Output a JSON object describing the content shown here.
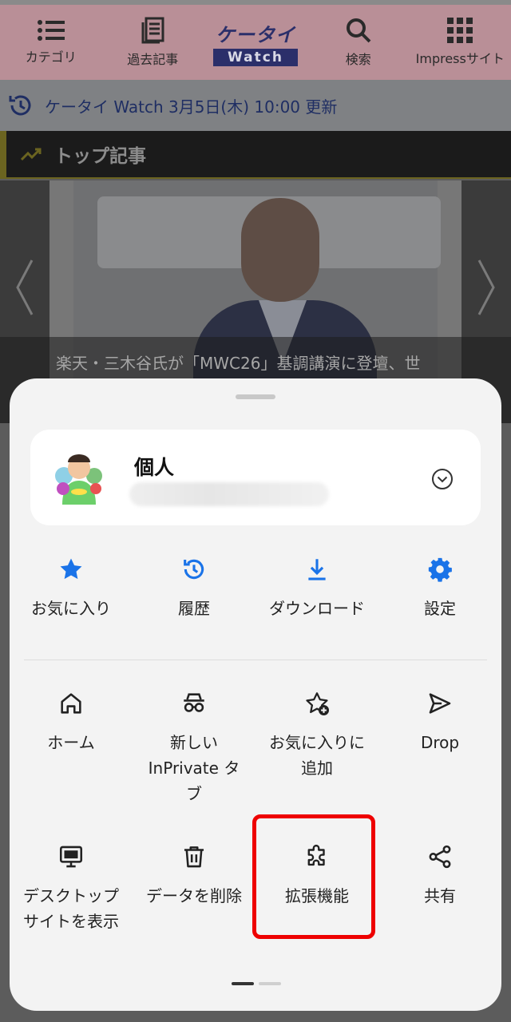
{
  "site_nav": {
    "items": [
      {
        "label": "カテゴリ",
        "icon": "list-icon"
      },
      {
        "label": "過去記事",
        "icon": "archive-icon"
      },
      {
        "label": "検索",
        "icon": "search-icon"
      },
      {
        "label": "Impressサイト",
        "icon": "grid-icon"
      }
    ],
    "logo_top": "ケータイ",
    "logo_bottom": "Watch"
  },
  "update_bar": {
    "text": "ケータイ Watch 3月5日(木) 10:00 更新",
    "icon": "clock-icon"
  },
  "section": {
    "title": "トップ記事",
    "icon": "trending-icon"
  },
  "carousel": {
    "caption": "楽天・三木谷氏が「MWC26」基調講演に登壇、世"
  },
  "sheet": {
    "account": {
      "name": "個人",
      "email": "",
      "chevron_icon": "chevron-down-circle-icon"
    },
    "row1": [
      {
        "label": "お気に入り",
        "icon": "star-icon"
      },
      {
        "label": "履歴",
        "icon": "history-icon"
      },
      {
        "label": "ダウンロード",
        "icon": "download-icon"
      },
      {
        "label": "設定",
        "icon": "gear-icon"
      }
    ],
    "row2": [
      {
        "label": "ホーム",
        "icon": "home-icon"
      },
      {
        "label": "新しい InPrivate タブ",
        "icon": "inprivate-icon"
      },
      {
        "label": "お気に入りに追加",
        "icon": "star-add-icon"
      },
      {
        "label": "Drop",
        "icon": "send-icon"
      }
    ],
    "row3": [
      {
        "label": "デスクトップ サイトを表示",
        "icon": "desktop-icon"
      },
      {
        "label": "データを削除",
        "icon": "trash-icon"
      },
      {
        "label": "拡張機能",
        "icon": "puzzle-icon"
      },
      {
        "label": "共有",
        "icon": "share-icon"
      }
    ],
    "highlighted_item": "拡張機能",
    "colors": {
      "accent": "#1a73e8",
      "highlight": "#ee0000"
    }
  }
}
